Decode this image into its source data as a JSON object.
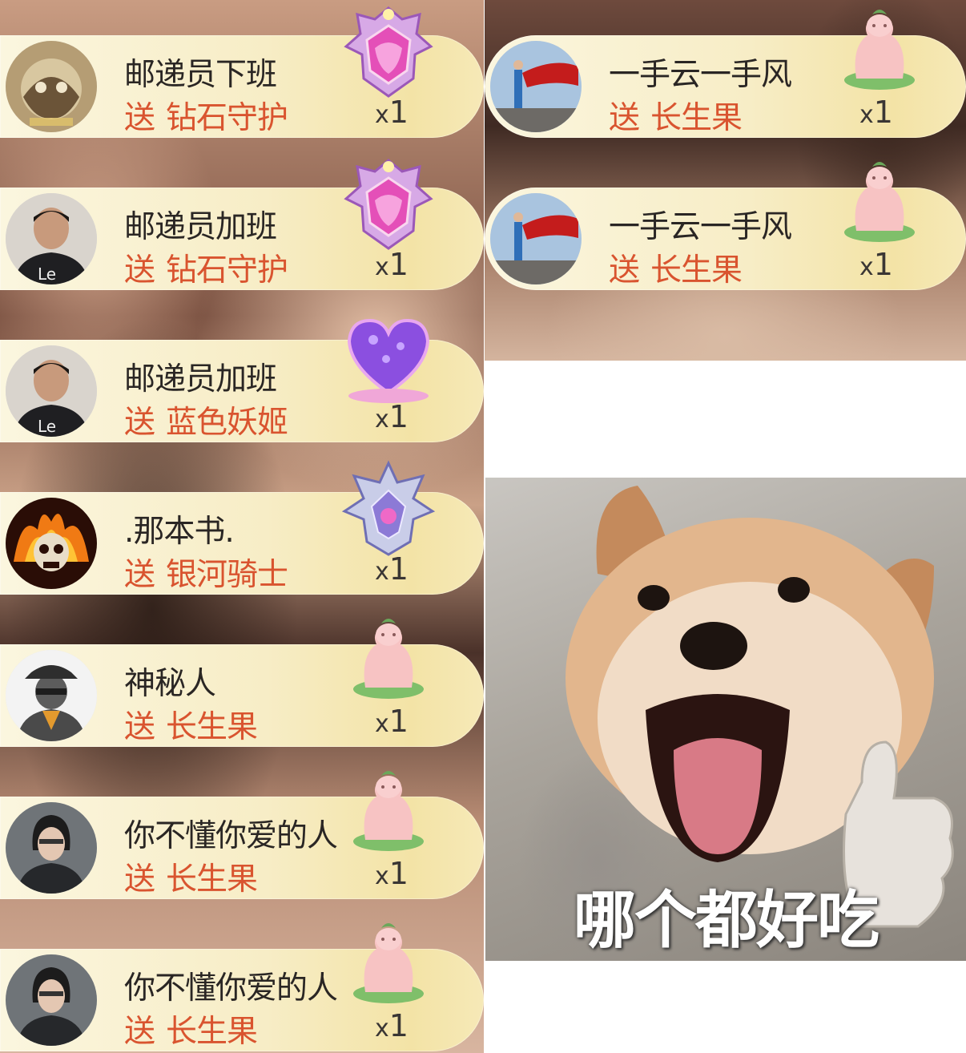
{
  "left_feed": [
    {
      "username": "邮递员下班",
      "verb": "送",
      "gift": "钻石守护",
      "x": "x",
      "count": "1",
      "gift_icon": "diamond-guard-icon"
    },
    {
      "username": "邮递员加班",
      "verb": "送",
      "gift": "钻石守护",
      "x": "x",
      "count": "1",
      "gift_icon": "diamond-guard-icon"
    },
    {
      "username": "邮递员加班",
      "verb": "送",
      "gift": "蓝色妖姬",
      "x": "x",
      "count": "1",
      "gift_icon": "purple-heart-icon"
    },
    {
      "username": ".那本书.",
      "verb": "送",
      "gift": "银河骑士",
      "x": "x",
      "count": "1",
      "gift_icon": "galaxy-knight-icon"
    },
    {
      "username": "神秘人",
      "verb": "送",
      "gift": "长生果",
      "x": "x",
      "count": "1",
      "gift_icon": "longevity-fruit-icon"
    },
    {
      "username": "你不懂你爱的人",
      "verb": "送",
      "gift": "长生果",
      "x": "x",
      "count": "1",
      "gift_icon": "longevity-fruit-icon"
    },
    {
      "username": "你不懂你爱的人",
      "verb": "送",
      "gift": "长生果",
      "x": "x",
      "count": "1",
      "gift_icon": "longevity-fruit-icon"
    }
  ],
  "right_feed": [
    {
      "username": "一手云一手风",
      "verb": "送",
      "gift": "长生果",
      "x": "x",
      "count": "1",
      "gift_icon": "longevity-fruit-icon"
    },
    {
      "username": "一手云一手风",
      "verb": "送",
      "gift": "长生果",
      "x": "x",
      "count": "1",
      "gift_icon": "longevity-fruit-icon"
    }
  ],
  "meme": {
    "caption": "哪个都好吃"
  },
  "colors": {
    "gift_text": "#d9542f",
    "username": "#2a2624",
    "row_bg": "#f7edc6"
  }
}
